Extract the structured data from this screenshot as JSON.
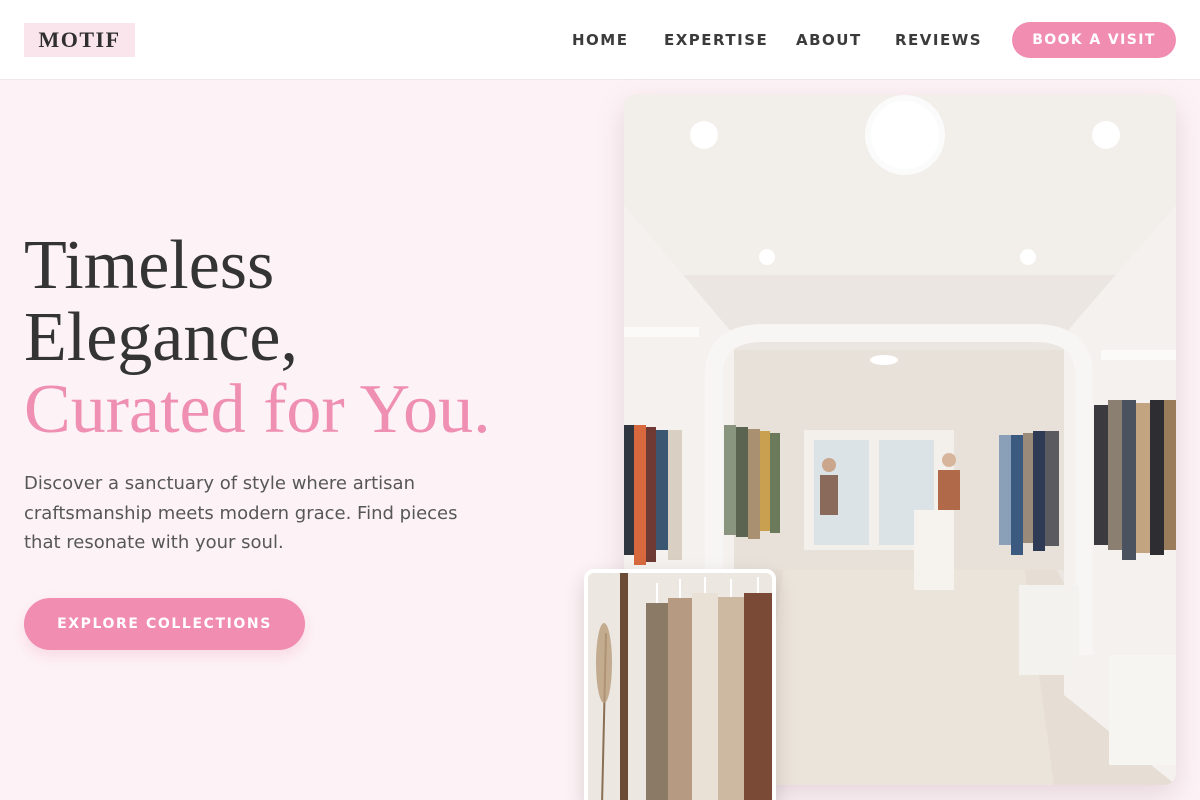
{
  "brand": {
    "logo_text": "MOTIF",
    "accent_color": "#f08db1",
    "logo_bg": "#fbe5ec"
  },
  "nav": {
    "items": [
      {
        "label": "HOME"
      },
      {
        "label": "EXPERTISE"
      },
      {
        "label": "ABOUT"
      },
      {
        "label": "REVIEWS"
      }
    ],
    "cta_label": "BOOK A VISIT"
  },
  "hero": {
    "title_line1": "Timeless",
    "title_line2": "Elegance,",
    "title_accent": "Curated for You.",
    "subtitle": "Discover a sanctuary of style where artisan craftsmanship meets modern grace. Find pieces that resonate with your soul.",
    "cta_label": "EXPLORE COLLECTIONS"
  },
  "images": {
    "main": {
      "subject": "boutique-interior-photo"
    },
    "secondary": {
      "subject": "clothing-rack-photo"
    }
  }
}
